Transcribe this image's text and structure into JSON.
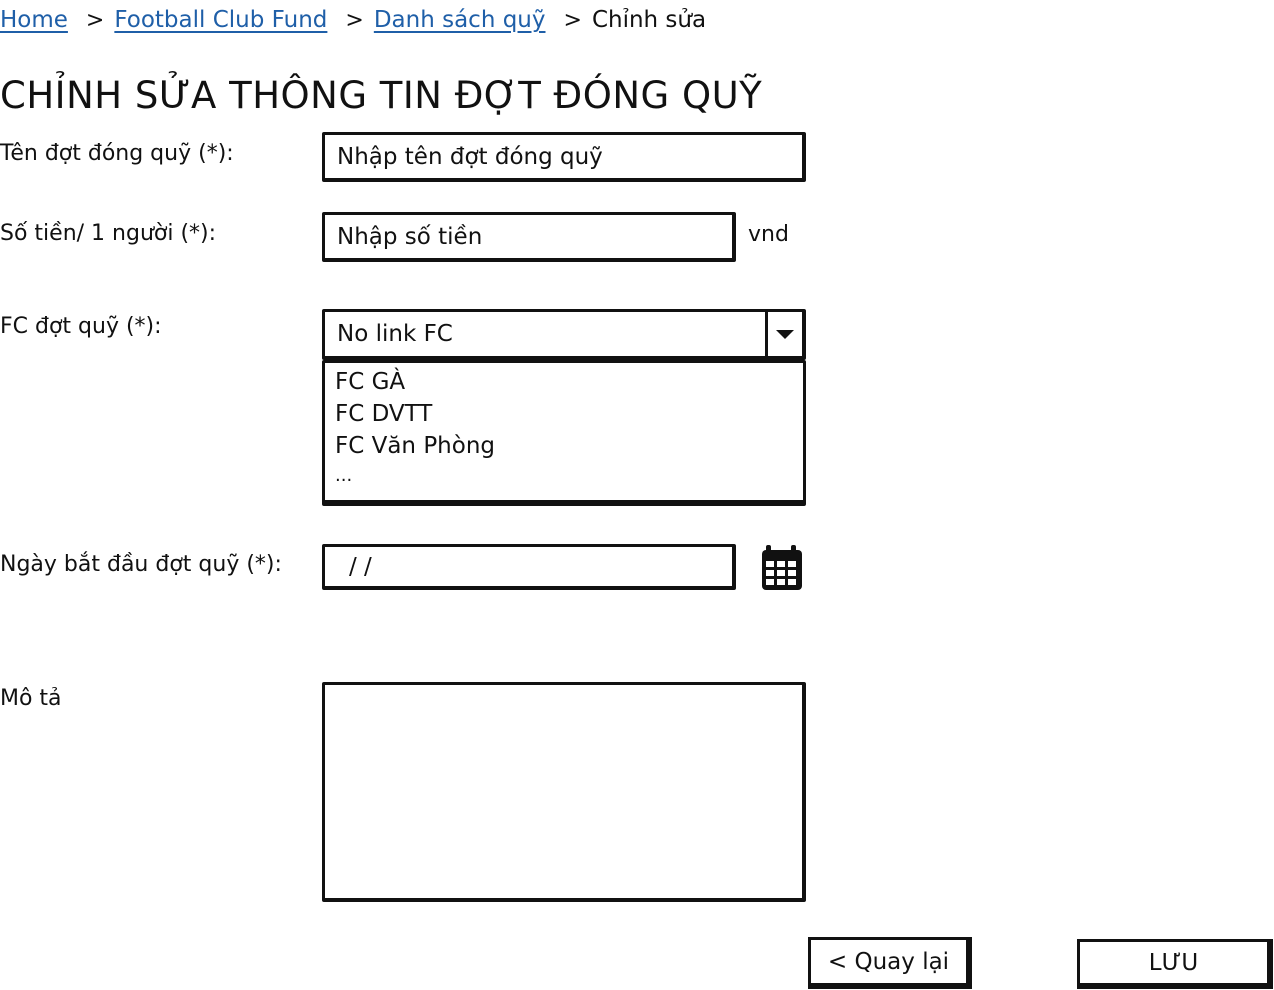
{
  "breadcrumb": {
    "home": "Home",
    "fund": "Football Club Fund",
    "list": "Danh sách quỹ",
    "current": "Chỉnh sửa",
    "separator": ">"
  },
  "page_title": "CHỈNH SỬA THÔNG TIN ĐỢT ĐÓNG QUỸ",
  "form": {
    "name_label": "Tên đợt đóng quỹ (*):",
    "name_placeholder": "Nhập tên đợt đóng quỹ",
    "amount_label": "Số tiền/ 1 người (*):",
    "amount_placeholder": "Nhập số tiền",
    "amount_unit": "vnd",
    "fc_label": "FC đợt quỹ (*):",
    "fc_selected": "No link FC",
    "fc_options": [
      "FC GÀ",
      "FC DVTT",
      "FC Văn Phòng",
      "..."
    ],
    "start_date_label": "Ngày bắt đầu đợt quỹ (*):",
    "start_date_value": "/  /",
    "description_label": "Mô tả",
    "description_value": ""
  },
  "buttons": {
    "back": "< Quay lại",
    "save": "LƯU"
  },
  "icons": {
    "calendar": "calendar-icon",
    "dropdown": "chevron-down-icon"
  },
  "colors": {
    "link": "#1f5fa8",
    "border": "#111111"
  }
}
